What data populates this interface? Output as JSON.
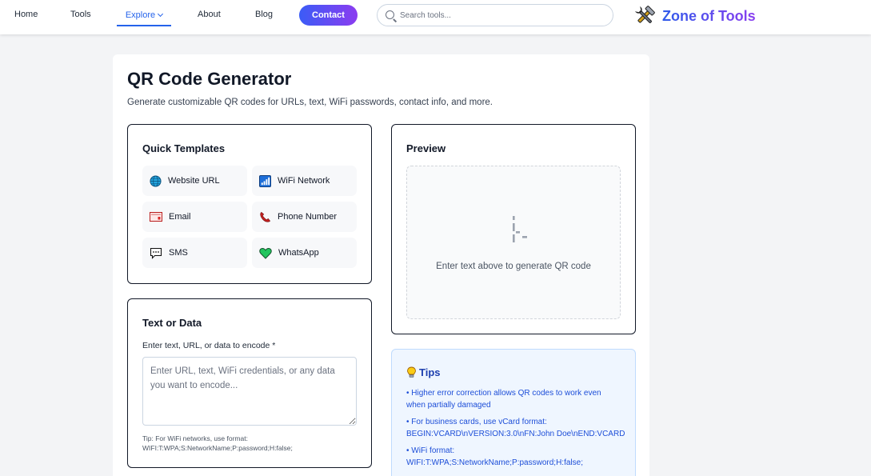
{
  "nav": {
    "home": "Home",
    "tools": "Tools",
    "explore": "Explore",
    "about": "About",
    "blog": "Blog",
    "contact": "Contact",
    "search_placeholder": "Search tools...",
    "brand": "Zone of Tools"
  },
  "page": {
    "title": "QR Code Generator",
    "subtitle": "Generate customizable QR codes for URLs, text, WiFi passwords, contact info, and more."
  },
  "templates": {
    "title": "Quick Templates",
    "items": [
      {
        "label": "Website URL",
        "icon": "globe-icon"
      },
      {
        "label": "WiFi Network",
        "icon": "wifi-icon"
      },
      {
        "label": "Email",
        "icon": "email-icon"
      },
      {
        "label": "Phone Number",
        "icon": "phone-icon"
      },
      {
        "label": "SMS",
        "icon": "sms-icon"
      },
      {
        "label": "WhatsApp",
        "icon": "heart-icon"
      }
    ]
  },
  "text_data": {
    "title": "Text or Data",
    "label": "Enter text, URL, or data to encode *",
    "placeholder": "Enter URL, text, WiFi credentials, or any data you want to encode...",
    "tip_line1": "Tip: For WiFi networks, use format:",
    "tip_line2": "WIFI:T:WPA;S:NetworkName;P:password;H:false;"
  },
  "preview": {
    "title": "Preview",
    "message": "Enter text above to generate QR code"
  },
  "tips": {
    "title": "Tips",
    "lines": [
      "• Higher error correction allows QR codes to work even",
      "when partially damaged",
      "• For business cards, use vCard format:",
      "BEGIN:VCARD\\nVERSION:3.0\\nFN:John Doe\\nEND:VCARD",
      "• WiFi format:",
      "WIFI:T:WPA;S:NetworkName;P:password;H:false;"
    ]
  },
  "colors": {
    "accent": "#2563eb",
    "brand_gradient_start": "#2f5bea",
    "brand_gradient_end": "#8b3ff0",
    "tips_bg": "#eff6ff",
    "tips_text": "#1d4ed8"
  }
}
